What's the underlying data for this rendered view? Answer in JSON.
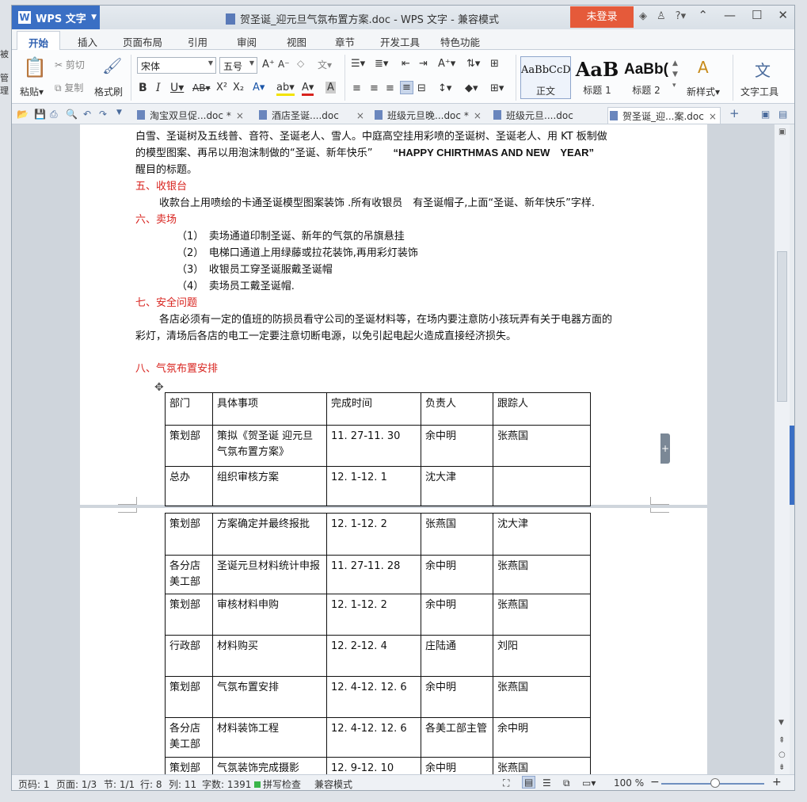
{
  "titlebar": {
    "app_name": "WPS 文字",
    "doc_title": "贺圣诞_迎元旦气氛布置方案.doc - WPS 文字 - 兼容模式",
    "login": "未登录",
    "help": "?"
  },
  "menu": {
    "tabs": [
      "开始",
      "插入",
      "页面布局",
      "引用",
      "审阅",
      "视图",
      "章节",
      "开发工具",
      "特色功能"
    ]
  },
  "ribbon": {
    "paste": "粘贴",
    "cut": "剪切",
    "copy": "复制",
    "format_painter": "格式刷",
    "font_name": "宋体",
    "font_size": "五号",
    "styles": [
      {
        "sample": "AaBbCcD",
        "label": "正文"
      },
      {
        "sample": "AaB",
        "label": "标题 1"
      },
      {
        "sample": "AaBb(",
        "label": "标题 2"
      }
    ],
    "new_style": "新样式",
    "text_tools": "文字工具"
  },
  "doc_tabs": [
    {
      "label": "淘宝双旦促...doc *",
      "close": "×"
    },
    {
      "label": "酒店圣诞....doc",
      "close": "×"
    },
    {
      "label": "班级元旦晚...doc *",
      "close": "×"
    },
    {
      "label": "班级元旦....doc",
      "close": ""
    },
    {
      "label": "贺圣诞_迎...案.doc",
      "close": "×"
    }
  ],
  "document": {
    "lines": [
      "白雪、圣诞树及五线普、音符、圣诞老人、雪人。中庭高空挂用彩喷的圣诞树、圣诞老人、用 KT 板制做",
      "的模型图案、再吊以用泡沫制做的“圣诞、新年快乐”",
      "醒目的标题。",
      "五、收银台",
      "收款台上用喷绘的卡通圣诞模型图案装饰 .所有收银员　有圣诞帽子,上面“圣诞、新年快乐”字样.",
      "六、卖场",
      "（1）　卖场通道印制圣诞、新年的气氛的吊旗悬挂",
      "（2）　电梯口通道上用绿藤或拉花装饰,再用彩灯装饰",
      "（3）　收银员工穿圣诞服戴圣诞帽",
      "（4）　卖场员工戴圣诞帽.",
      "七、安全问题",
      "各店必须有一定的值班的防损员看守公司的圣诞材料等，在场内要注意防小孩玩弄有关于电器方面的",
      "彩灯，清场后各店的电工一定要注意切断电源，以免引起电起火造成直接经济损失。",
      "八、气氛布置安排"
    ],
    "english_title": "“HAPPY CHIRTHMAS AND NEW　YEAR”",
    "table_headers": [
      "部门",
      "具体事项",
      "完成时间",
      "负责人",
      "跟踪人"
    ],
    "table_rows_page1": [
      [
        "策划部",
        "策拟《贺圣诞 迎元旦气氛布置方案》",
        "11. 27-11. 30",
        "余中明",
        "张燕国"
      ],
      [
        "总办",
        "组织审核方案",
        "12. 1-12. 1",
        "沈大津",
        ""
      ]
    ],
    "table_rows_page2": [
      [
        "策划部",
        "方案确定并最终报批",
        "12. 1-12. 2",
        "张燕国",
        "沈大津"
      ],
      [
        "各分店美工部",
        "圣诞元旦材料统计申报",
        "11. 27-11. 28",
        "余中明",
        "张燕国"
      ],
      [
        "策划部",
        "审核材料申购",
        "12. 1-12. 2",
        "余中明",
        "张燕国"
      ],
      [
        "行政部",
        "材料购买",
        "12. 2-12. 4",
        "庄陆通",
        "刘阳"
      ],
      [
        "策划部",
        "气氛布置安排",
        "12. 4-12. 12. 6",
        "余中明",
        "张燕国"
      ],
      [
        "各分店美工部",
        "材料装饰工程",
        "12. 4-12. 12. 6",
        "各美工部主管",
        "余中明"
      ],
      [
        "策划部",
        "气氛装饰完成摄影",
        "12. 9-12. 10",
        "余中明",
        "张燕国"
      ]
    ]
  },
  "statusbar": {
    "page_code": "页码: 1",
    "page": "页面: 1/3",
    "section": "节: 1/1",
    "row": "行: 8",
    "col": "列: 11",
    "words": "字数: 1391",
    "spell": "拼写检查",
    "compat": "兼容模式",
    "zoom": "100 %"
  },
  "left_edge": {
    "label1": "被",
    "label2": "管理"
  }
}
